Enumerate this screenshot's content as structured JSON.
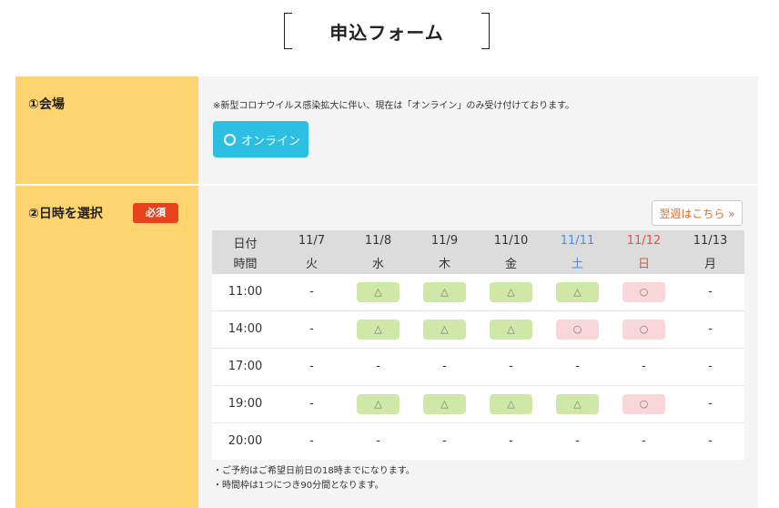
{
  "title": "申込フォーム",
  "venue": {
    "label": "①会場",
    "notice": "※新型コロナウイルス感染拡大に伴い、現在は「オンライン」のみ受け付けております。",
    "option_label": "オンライン"
  },
  "datetime": {
    "label": "②日時を選択",
    "required_badge": "必須",
    "next_week_label": "翌週はこちら »",
    "header_row1_first": "日付",
    "header_row2_first": "時間",
    "days": [
      {
        "date": "11/7",
        "weekday": "火",
        "color": "#333333"
      },
      {
        "date": "11/8",
        "weekday": "水",
        "color": "#333333"
      },
      {
        "date": "11/9",
        "weekday": "木",
        "color": "#333333"
      },
      {
        "date": "11/10",
        "weekday": "金",
        "color": "#333333"
      },
      {
        "date": "11/11",
        "weekday": "土",
        "color": "#4a8ee0"
      },
      {
        "date": "11/12",
        "weekday": "日",
        "color": "#e5533b"
      },
      {
        "date": "11/13",
        "weekday": "月",
        "color": "#333333"
      }
    ],
    "rows": [
      {
        "time": "11:00",
        "cells": [
          "-",
          "△",
          "△",
          "△",
          "△",
          "○",
          "-"
        ]
      },
      {
        "time": "14:00",
        "cells": [
          "-",
          "△",
          "△",
          "△",
          "○",
          "○",
          "-"
        ]
      },
      {
        "time": "17:00",
        "cells": [
          "-",
          "-",
          "-",
          "-",
          "-",
          "-",
          "-"
        ]
      },
      {
        "time": "19:00",
        "cells": [
          "-",
          "△",
          "△",
          "△",
          "△",
          "○",
          "-"
        ]
      },
      {
        "time": "20:00",
        "cells": [
          "-",
          "-",
          "-",
          "-",
          "-",
          "-",
          "-"
        ]
      }
    ],
    "notes": [
      "・ご予約はご希望日前日の18時までになります。",
      "・時間枠は1つにつき90分間となります。"
    ]
  },
  "colors": {
    "label_bg": "#fdd46f",
    "accent_button": "#2cbfe1",
    "required_badge": "#e8421d",
    "slot_available_few": "#cfe7a7",
    "slot_available": "#f9d6d9"
  }
}
